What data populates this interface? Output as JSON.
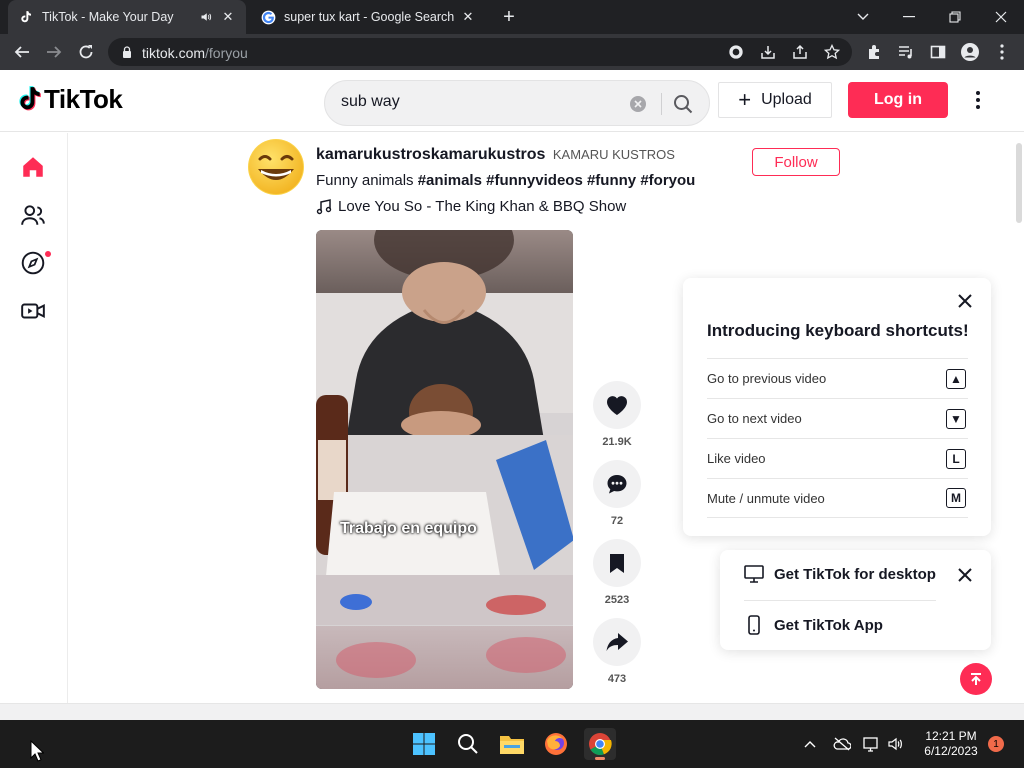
{
  "browser": {
    "tabs": [
      {
        "title": "TikTok - Make Your Day",
        "active": true
      },
      {
        "title": "super tux kart - Google Search",
        "active": false
      }
    ],
    "url_host": "tiktok.com",
    "url_path": "/foryou"
  },
  "header": {
    "logo_text": "TikTok",
    "search_value": "sub way",
    "upload_label": "Upload",
    "login_label": "Log in"
  },
  "post": {
    "username": "kamarukustroskamarukustros",
    "nickname": "KAMARU KUSTROS",
    "follow_label": "Follow",
    "caption_text": "Funny animals",
    "hashtags": [
      "#animals",
      "#funnyvideos",
      "#funny",
      "#foryou"
    ],
    "music": "Love You So - The King Khan & BBQ Show",
    "video_overlay_text": "Trabajo en equipo",
    "likes": "21.9K",
    "comments": "72",
    "saves": "2523",
    "shares": "473"
  },
  "keyboard_panel": {
    "title": "Introducing keyboard shortcuts!",
    "rows": [
      {
        "label": "Go to previous video",
        "key": "▲"
      },
      {
        "label": "Go to next video",
        "key": "▼"
      },
      {
        "label": "Like video",
        "key": "L"
      },
      {
        "label": "Mute / unmute video",
        "key": "M"
      }
    ]
  },
  "app_panel": {
    "desktop_label": "Get TikTok for desktop",
    "app_label": "Get TikTok App"
  },
  "taskbar": {
    "time": "12:21 PM",
    "date": "6/12/2023",
    "notification_count": "1"
  },
  "colors": {
    "brand": "#fe2c55",
    "chrome_dark": "#202124",
    "chrome_toolbar": "#35363a"
  }
}
